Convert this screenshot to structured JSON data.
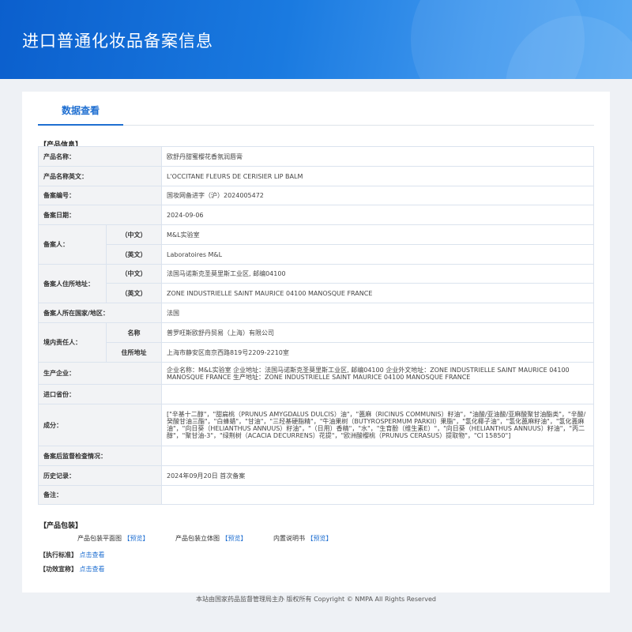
{
  "header": {
    "title": "进口普通化妆品备案信息"
  },
  "tab": {
    "label": "数据查看"
  },
  "product_info": {
    "section_title": "【产品信息】",
    "product_name_label": "产品名称：",
    "product_name": "欧舒丹甜蜜樱花香氛润唇膏",
    "product_name_en_label": "产品名称英文：",
    "product_name_en": "L'OCCITANE FLEURS DE CERISIER LIP BALM",
    "record_no_label": "备案编号：",
    "record_no": "国妆网备进字（沪）2024005472",
    "record_date_label": "备案日期：",
    "record_date": "2024-09-06",
    "registrant_label": "备案人：",
    "cn_label": "（中文）",
    "en_label": "（英文）",
    "registrant_cn": "M&L实验室",
    "registrant_en": "Laboratoires M&L",
    "address_label": "备案人住所地址：",
    "address_cn": "法国马诺斯克圣莫里斯工业区, 邮编04100",
    "address_en": "ZONE INDUSTRIELLE SAINT MAURICE 04100 MANOSQUE FRANCE",
    "country_label": "备案人所在国家/地区：",
    "country": "法国",
    "domestic_label": "境内责任人：",
    "name_label": "名称",
    "domestic_name": "普罗旺斯欧舒丹贸易（上海）有限公司",
    "domestic_addr_label": "住所地址",
    "domestic_addr": "上海市静安区南京西路819号2209-2210室",
    "manufacturer_label": "生产企业：",
    "manufacturer": "企业名称：M&L实验室 企业地址：法国马诺斯克圣莫里斯工业区, 邮编04100 企业外文地址：ZONE INDUSTRIELLE SAINT MAURICE 04100 MANOSQUE FRANCE 生产地址：ZONE INDUSTRIELLE SAINT MAURICE 04100 MANOSQUE FRANCE",
    "import_province_label": "进口省份：",
    "import_province": "",
    "ingredients_label": "成分：",
    "ingredients": "[\"辛基十二醇\"，\"甜扁桃（PRUNUS AMYGDALUS DULCIS）油\"，\"蓖麻（RICINUS COMMUNIS）籽油\"，\"油酸/亚油酸/亚麻酸聚甘油酯类\"，\"辛酸/癸酸甘油三酯\"，\"白蜂蜡\"，\"甘油\"，\"三羟基硬脂精\"，\"牛油果树（BUTYROSPERMUM PARKII）果脂\"，\"氢化椰子油\"，\"氢化蓖麻籽油\"，\"氢化蓖麻油\"，\"向日葵（HELIANTHUS ANNUUS）籽油\"，\"（日用）香精\"，\"水\"，\"生育酚（维生素E）\"，\"向日葵（HELIANTHUS ANNUUS）籽油\"，\"丙二醇\"，\"聚甘油-3\"，\"绿荆树（ACACIA DECURRENS）花提\"，\"欧洲酸樱桃（PRUNUS CERASUS）提取物\"，\"CI 15850\"]",
    "post_check_label": "备案后监督检查情况：",
    "post_check": "",
    "history_label": "历史记录：",
    "history": "2024年09月20日 首次备案",
    "remark_label": "备注：",
    "remark": ""
  },
  "packaging": {
    "section_title": "【产品包装】",
    "flat_label": "产品包装平面图",
    "solid_label": "产品包装立体图",
    "manual_label": "内置说明书",
    "preview_link": "【预览】"
  },
  "standard": {
    "section_title": "【执行标准】",
    "link": "点击查看"
  },
  "efficacy": {
    "section_title": "【功效宣称】",
    "link": "点击查看"
  },
  "footer": {
    "text": "本站由国家药品监督管理局主办 版权所有 Copyright © NMPA All Rights Reserved"
  }
}
